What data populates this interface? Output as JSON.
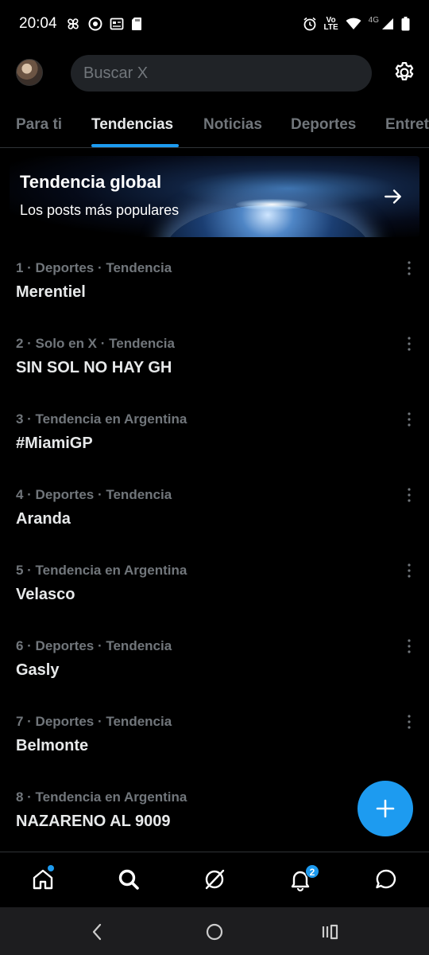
{
  "status_bar": {
    "time": "20:04",
    "volte_label": "Vo\nLTE",
    "network": "4G"
  },
  "header": {
    "search_placeholder": "Buscar X"
  },
  "tabs": [
    {
      "label": "Para ti"
    },
    {
      "label": "Tendencias"
    },
    {
      "label": "Noticias"
    },
    {
      "label": "Deportes"
    },
    {
      "label": "Entret"
    }
  ],
  "banner": {
    "title": "Tendencia global",
    "subtitle": "Los posts más populares"
  },
  "trends": [
    {
      "meta": "1 · Deportes · Tendencia",
      "name": "Merentiel"
    },
    {
      "meta": "2 · Solo en X · Tendencia",
      "name": "SIN SOL NO HAY GH"
    },
    {
      "meta": "3 · Tendencia en Argentina",
      "name": "#MiamiGP"
    },
    {
      "meta": "4 · Deportes · Tendencia",
      "name": "Aranda"
    },
    {
      "meta": "5 · Tendencia en Argentina",
      "name": "Velasco"
    },
    {
      "meta": "6 · Deportes · Tendencia",
      "name": "Gasly"
    },
    {
      "meta": "7 · Deportes · Tendencia",
      "name": "Belmonte"
    },
    {
      "meta": "8 · Tendencia en Argentina",
      "name": "NAZARENO AL 9009"
    }
  ],
  "bottom_nav": {
    "notifications_badge": "2"
  },
  "colors": {
    "accent": "#1d9bf0",
    "background": "#000000",
    "secondary_text": "#71767b",
    "primary_text": "#e7e9ea"
  }
}
